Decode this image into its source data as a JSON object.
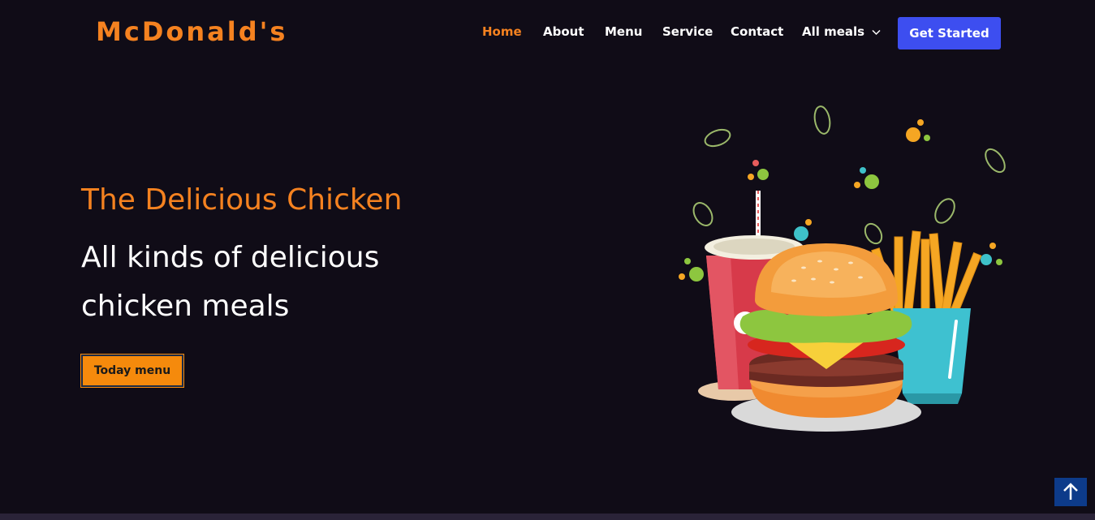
{
  "brand": {
    "name": "McDonald's"
  },
  "nav": {
    "items": [
      {
        "label": "Home",
        "active": true
      },
      {
        "label": "About"
      },
      {
        "label": "Menu"
      },
      {
        "label": "Service"
      },
      {
        "label": "Contact"
      },
      {
        "label": "All meals",
        "dropdown": true
      }
    ],
    "cta_label": "Get Started"
  },
  "hero": {
    "title": "The Delicious Chicken",
    "subtitle": "All kinds of delicious chicken meals",
    "button_label": "Today menu",
    "image": "burger-fries-drink-illustration"
  },
  "colors": {
    "background": "#100c17",
    "accent": "#f58220",
    "cta": "#3d4ef0",
    "scroll_button": "#0d3b8a"
  },
  "icons": {
    "dropdown": "chevron-down-icon",
    "scroll_top": "arrow-up-icon"
  }
}
